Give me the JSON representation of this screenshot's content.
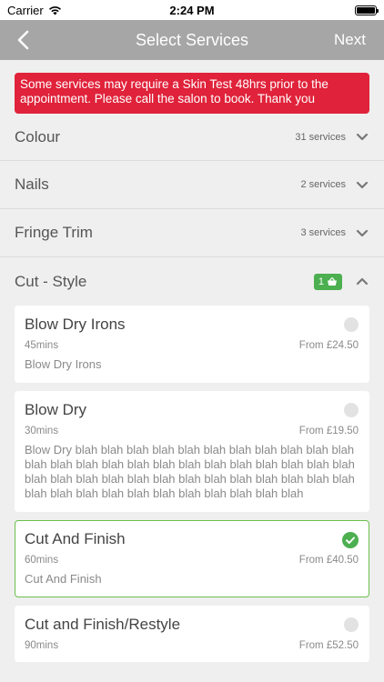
{
  "status": {
    "carrier": "Carrier",
    "time": "2:24 PM"
  },
  "nav": {
    "title": "Select Services",
    "next_label": "Next"
  },
  "banner": {
    "text": "Some services may require a Skin Test 48hrs prior to the appointment. Please call the salon to book. Thank you"
  },
  "categories": [
    {
      "name": "Colour",
      "count": "31 services"
    },
    {
      "name": "Nails",
      "count": "2 services"
    },
    {
      "name": "Fringe Trim",
      "count": "3 services"
    },
    {
      "name": "Cut - Style",
      "badge": "1"
    }
  ],
  "services": [
    {
      "name": "Blow Dry Irons",
      "duration": "45mins",
      "price": "From £24.50",
      "desc": "Blow Dry Irons",
      "selected": false
    },
    {
      "name": "Blow Dry",
      "duration": "30mins",
      "price": "From £19.50",
      "desc": "Blow Dry blah blah blah blah blah blah blah blah blah blah blah blah blah blah blah blah blah blah blah blah blah blah blah blah blah blah blah blah blah blah blah blah blah blah blah blah blah blah blah blah blah blah blah blah blah blah blah blah",
      "selected": false
    },
    {
      "name": "Cut And Finish",
      "duration": "60mins",
      "price": "From £40.50",
      "desc": "Cut And Finish",
      "selected": true
    },
    {
      "name": "Cut and Finish/Restyle",
      "duration": "90mins",
      "price": "From £52.50",
      "selected": false
    }
  ],
  "colors": {
    "nav": "#a6a6a6",
    "banner": "#e0223a",
    "accent": "#4caf50"
  },
  "icons": {
    "back": "chevron-left-icon",
    "expand": "chevron-down-icon",
    "collapse": "chevron-up-icon",
    "basket": "basket-icon",
    "check": "check-circle-icon"
  }
}
